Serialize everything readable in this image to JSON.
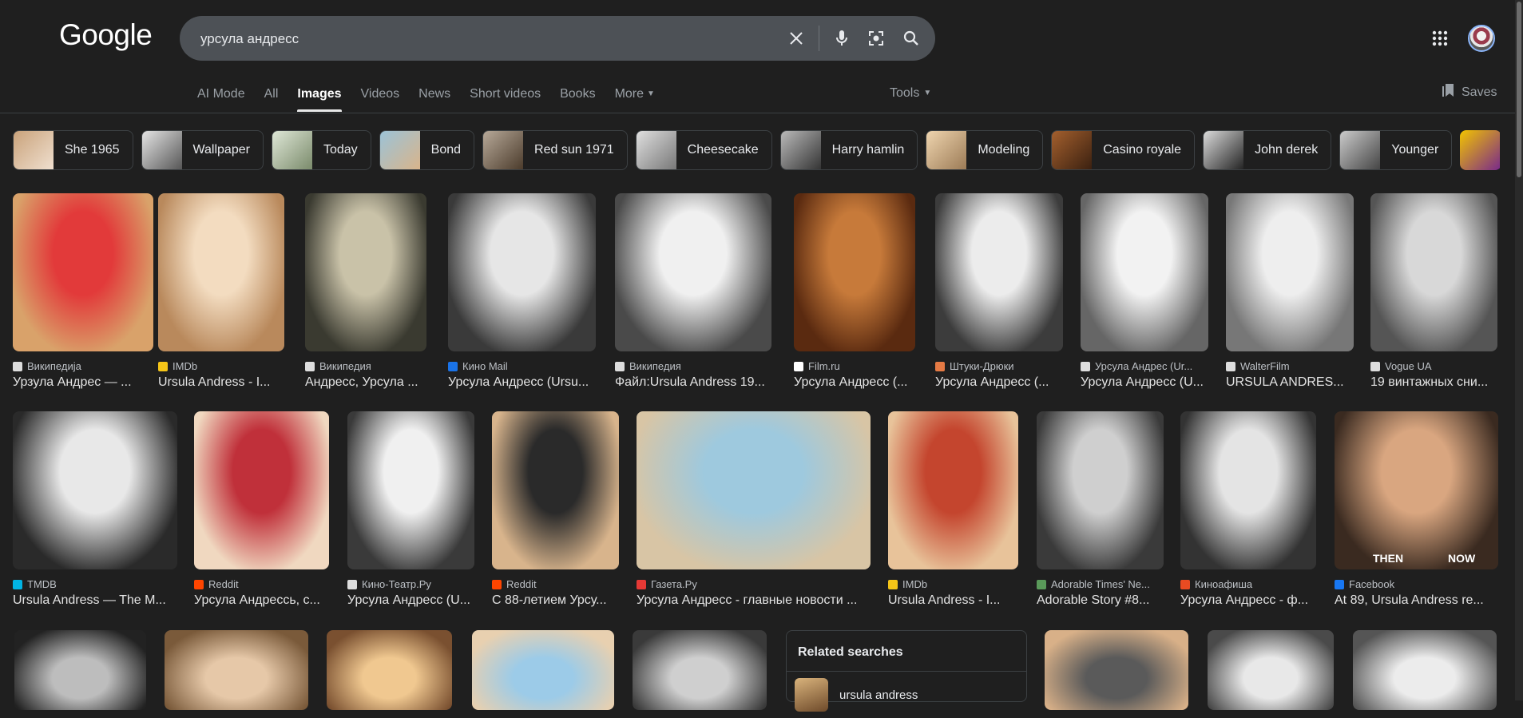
{
  "header": {
    "logo": "Google",
    "query": "урсула андресс",
    "saves_label": "Saves"
  },
  "tabs": [
    {
      "label": "AI Mode",
      "active": false
    },
    {
      "label": "All",
      "active": false
    },
    {
      "label": "Images",
      "active": true
    },
    {
      "label": "Videos",
      "active": false
    },
    {
      "label": "News",
      "active": false
    },
    {
      "label": "Short videos",
      "active": false
    },
    {
      "label": "Books",
      "active": false
    },
    {
      "label": "More",
      "active": false
    }
  ],
  "tools_label": "Tools",
  "chips": [
    {
      "label": "She 1965",
      "tone": [
        "#c9a27a",
        "#f0e0d0"
      ]
    },
    {
      "label": "Wallpaper",
      "tone": [
        "#e6e6e6",
        "#555"
      ]
    },
    {
      "label": "Today",
      "tone": [
        "#dfe8d8",
        "#7a8a6a"
      ]
    },
    {
      "label": "Bond",
      "tone": [
        "#9bc3d8",
        "#d9b48a"
      ]
    },
    {
      "label": "Red sun 1971",
      "tone": [
        "#b8aa9a",
        "#4a3a2a"
      ]
    },
    {
      "label": "Cheesecake",
      "tone": [
        "#e0e0e0",
        "#777"
      ]
    },
    {
      "label": "Harry hamlin",
      "tone": [
        "#bbb",
        "#333"
      ]
    },
    {
      "label": "Modeling",
      "tone": [
        "#f0d6b0",
        "#9b7a55"
      ]
    },
    {
      "label": "Casino royale",
      "tone": [
        "#a4602e",
        "#3a2010"
      ]
    },
    {
      "label": "John derek",
      "tone": [
        "#ddd",
        "#222"
      ]
    },
    {
      "label": "Younger",
      "tone": [
        "#ccc",
        "#444"
      ]
    }
  ],
  "row1": [
    {
      "source": "Википедија",
      "title": "Урзула Андрес — ...",
      "fav": "#ddd",
      "tone": [
        "#e23a3a",
        "#d9a26a"
      ]
    },
    {
      "source": "IMDb",
      "title": "Ursula Andress - I...",
      "fav": "#f5c518",
      "tone": [
        "#f3dcc0",
        "#b9895c"
      ]
    },
    {
      "source": "Википедия",
      "title": "Андресс, Урсула ...",
      "fav": "#ddd",
      "tone": [
        "#c9c2a8",
        "#3a3a30"
      ]
    },
    {
      "source": "Кино Mail",
      "title": "Урсула Андресс (Ursu...",
      "fav": "#1a73e8",
      "tone": [
        "#e6e6e6",
        "#3a3a3a"
      ]
    },
    {
      "source": "Википедия",
      "title": "Файл:Ursula Andress 19...",
      "fav": "#ddd",
      "tone": [
        "#f0f0f0",
        "#4a4a4a"
      ]
    },
    {
      "source": "Film.ru",
      "title": "Урсула Андресс (...",
      "fav": "#fff",
      "tone": [
        "#c77a3a",
        "#5a2a10"
      ]
    },
    {
      "source": "Штуки-Дрюки",
      "title": "Урсула Андресс (...",
      "fav": "#e57a44",
      "tone": [
        "#ececec",
        "#3c3c3c"
      ]
    },
    {
      "source": "Урсула Андрес (Ur...",
      "title": "Урсула Андресс (U...",
      "fav": "#ddd",
      "tone": [
        "#f2f2f2",
        "#666"
      ]
    },
    {
      "source": "WalterFilm",
      "title": "URSULA ANDRES...",
      "fav": "#ddd",
      "tone": [
        "#eeeeee",
        "#777"
      ]
    },
    {
      "source": "Vogue UA",
      "title": "19 винтажных сни...",
      "fav": "#ddd",
      "tone": [
        "#d8d8d8",
        "#555"
      ]
    }
  ],
  "row2": [
    {
      "source": "TMDB",
      "title": "Ursula Andress — The M...",
      "fav": "#01b4e4",
      "tone": [
        "#e8e8e8",
        "#2a2a2a"
      ]
    },
    {
      "source": "Reddit",
      "title": "Урсула Андрессь, с...",
      "fav": "#ff4500",
      "tone": [
        "#c0303a",
        "#f0d8c0"
      ]
    },
    {
      "source": "Кино-Театр.Ру",
      "title": "Урсула Андресс (U...",
      "fav": "#ddd",
      "tone": [
        "#f0f0f0",
        "#3a3a3a"
      ]
    },
    {
      "source": "Reddit",
      "title": "С 88-летием Урсу...",
      "fav": "#ff4500",
      "tone": [
        "#2a2a2a",
        "#d8b48c"
      ]
    },
    {
      "source": "Газета.Ру",
      "title": "Урсула Андресс - главные новости ...",
      "fav": "#e53935",
      "tone": [
        "#9ec9de",
        "#d8c5a5"
      ]
    },
    {
      "source": "IMDb",
      "title": "Ursula Andress - I...",
      "fav": "#f5c518",
      "tone": [
        "#c4452e",
        "#e8c39a"
      ]
    },
    {
      "source": "Adorable Times' Ne...",
      "title": "Adorable Story #8...",
      "fav": "#5a9a5a",
      "tone": [
        "#cfcfcf",
        "#3a3a3a"
      ]
    },
    {
      "source": "Киноафиша",
      "title": "Урсула Андресс - ф...",
      "fav": "#e94b22",
      "tone": [
        "#e4e4e4",
        "#333"
      ]
    },
    {
      "source": "Facebook",
      "title": "At 89, Ursula Andress re...",
      "fav": "#1877f2",
      "tone": [
        "#d9a680",
        "#3a2a20"
      ]
    }
  ],
  "row2_overlay": {
    "then": "THEN",
    "now": "NOW"
  },
  "related": {
    "heading": "Related searches",
    "first_item": "ursula andress"
  }
}
